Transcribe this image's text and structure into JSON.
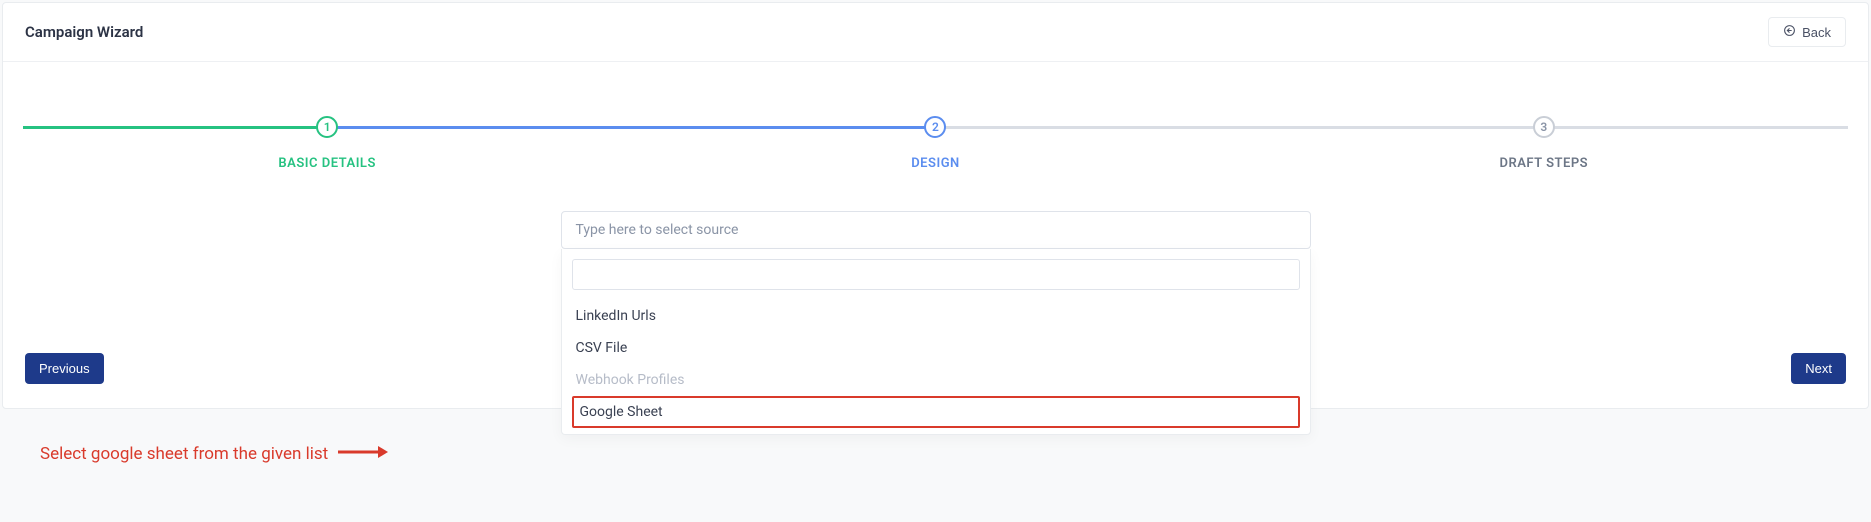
{
  "header": {
    "title": "Campaign Wizard",
    "back_label": "Back"
  },
  "steps": [
    {
      "num": "1",
      "label": "BASIC DETAILS"
    },
    {
      "num": "2",
      "label": "DESIGN"
    },
    {
      "num": "3",
      "label": "DRAFT STEPS"
    }
  ],
  "source_select": {
    "placeholder": "Type here to select source",
    "filter_value": "",
    "options": [
      {
        "label": "LinkedIn Urls",
        "disabled": false,
        "highlight": false
      },
      {
        "label": "CSV File",
        "disabled": false,
        "highlight": false
      },
      {
        "label": "Webhook Profiles",
        "disabled": true,
        "highlight": false
      },
      {
        "label": "Google Sheet",
        "disabled": false,
        "highlight": true
      }
    ]
  },
  "nav": {
    "prev_label": "Previous",
    "next_label": "Next"
  },
  "annotation": {
    "text": "Select google sheet from the given list"
  },
  "colors": {
    "green": "#26c281",
    "blue": "#5b8def",
    "gray": "#d9dde4",
    "danger": "#d93a2b",
    "navy": "#1e3a8a"
  }
}
